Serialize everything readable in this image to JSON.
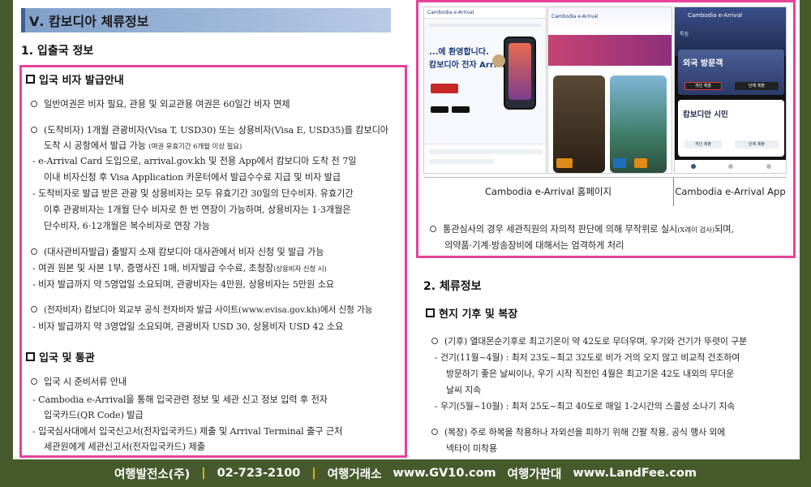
{
  "section_title": "Ⅴ. 캄보디아 체류정보",
  "h_entry": "1. 입출국 정보",
  "visa": {
    "heading": "입국 비자 발급안내",
    "l1": "일반여권은 비자 필요, 관용 및 외교관용 여권은 60일간 비자 면제",
    "l2": "(도착비자) 1개월 관광비자(Visa T, USD30) 또는 상용비자(Visa E, USD35)를 캄보디아",
    "l3a": "도착 시 공항에서 발급 가능 ",
    "l3b": "(여권 유효기간 6개월 이상 필요)",
    "l4": "- e-Arrival Card 도입으로, arrival.gov.kh 및 전용 App에서 캄보디아 도착 전 7일",
    "l5": "이내 비자신청 후 Visa Application 카운터에서 발급수수료 지급 및 비자 발급",
    "l6": "- 도착비자로 발급 받은 관광 및 상용비자는 모두 유효기간 30일의 단수비자. 유효기간",
    "l7": "이후 관광비자는 1개월 단수 비자로 한 번 연장이 가능하며, 상용비자는 1·3개월은",
    "l8": "단수비자, 6·12개월은 복수비자로 연장 가능",
    "l9": "(대사관비자발급) 출발지 소재 캄보디아 대사관에서 비자 신청 및 발급 가능",
    "l10a": "- 여권 원본 및 사본 1부, 증명사진 1매, 비자발급 수수료, 초청장",
    "l10b": "(상용비자 신청 시)",
    "l11": "- 비자 발급까지 약 5영업일 소요되며, 관광비자는 4만원, 상용비자는 5만원 소요",
    "l12": "(전자비자) 캄보디아 외교부 공식 전자비자 발급 사이트(www.evisa.gov.kh)에서 신청 가능",
    "l13": "- 비자 발급까지 약 3영업일 소요되며, 관광비자 USD 30, 상용비자 USD 42 소요"
  },
  "customs": {
    "heading": "입국 및 통관",
    "l1": "입국 시 준비서류 안내",
    "l2": "- Cambodia e-Arrival을 통해 입국관련 정보 및 세관 신고 정보 입력 후 전자",
    "l3": "입국카드(QR Code) 발급",
    "l4": "- 입국심사대에서 입국신고서(전자입국카드) 제출 및 Arrival Terminal 출구 근처",
    "l5": "세관원에게 세관신고서(전자입국카드) 제출"
  },
  "screens": {
    "caption_left": "Cambodia e-Arrival 홈페이지",
    "caption_right": "Cambodia e-Arrival App",
    "scr1_brand": "Cambodia e-Arrival",
    "scr1_welcome": "...에 환영합니다.",
    "scr1_sub": "캄보디아 전자 Arrival",
    "scr2_brand": "Cambodia e-Arrival",
    "scr3_brand": "Cambodia e-Arrival",
    "scr3_tab": "특징",
    "scr3_h1": "외국 방문객",
    "scr3_h2": "캄보디안 시민",
    "scr3_btn_a": "개인 제출",
    "scr3_btn_b": "단체 제출"
  },
  "customs_note": {
    "l1a": "통관심사의 경우 세관직원의 자의적 판단에 의해 무작위로 실시",
    "l1b": "(X레이 검사)",
    "l1c": "되며,",
    "l2": "의약품·기계·방송장비에 대해서는 엄격하게 처리"
  },
  "h_stay": "2. 체류정보",
  "climate": {
    "heading": "현지 기후 및 복장",
    "l1": "(기후) 열대몬순기후로 최고기온이 약 42도로 무더우며, 우기와 건기가 뚜렷이 구분",
    "l2": "- 건기(11월~4월) : 최저 23도~최고 32도로 비가 거의 오지 않고 비교적 건조하여",
    "l3": "방문하기 좋은 날씨이나, 우기 시작 직전인 4월은 최고기온 42도 내외의 무더운",
    "l4": "날씨 지속",
    "l5": "- 우기(5월~10월) : 최저 25도~최고 40도로 매일 1-2시간의 스콜성 소나기 지속",
    "l6": "(복장) 주로 하복을 착용하나 자외선을 피하기 위해 긴팔 착용, 공식 행사 외에",
    "l7": "넥타이 미착용"
  },
  "footer": {
    "a": "여행발전소(주)",
    "b": "02-723-2100",
    "c": "여행거래소",
    "d": "www.GV10.com",
    "e": "여행가판대",
    "f": "www.LandFee.com"
  }
}
